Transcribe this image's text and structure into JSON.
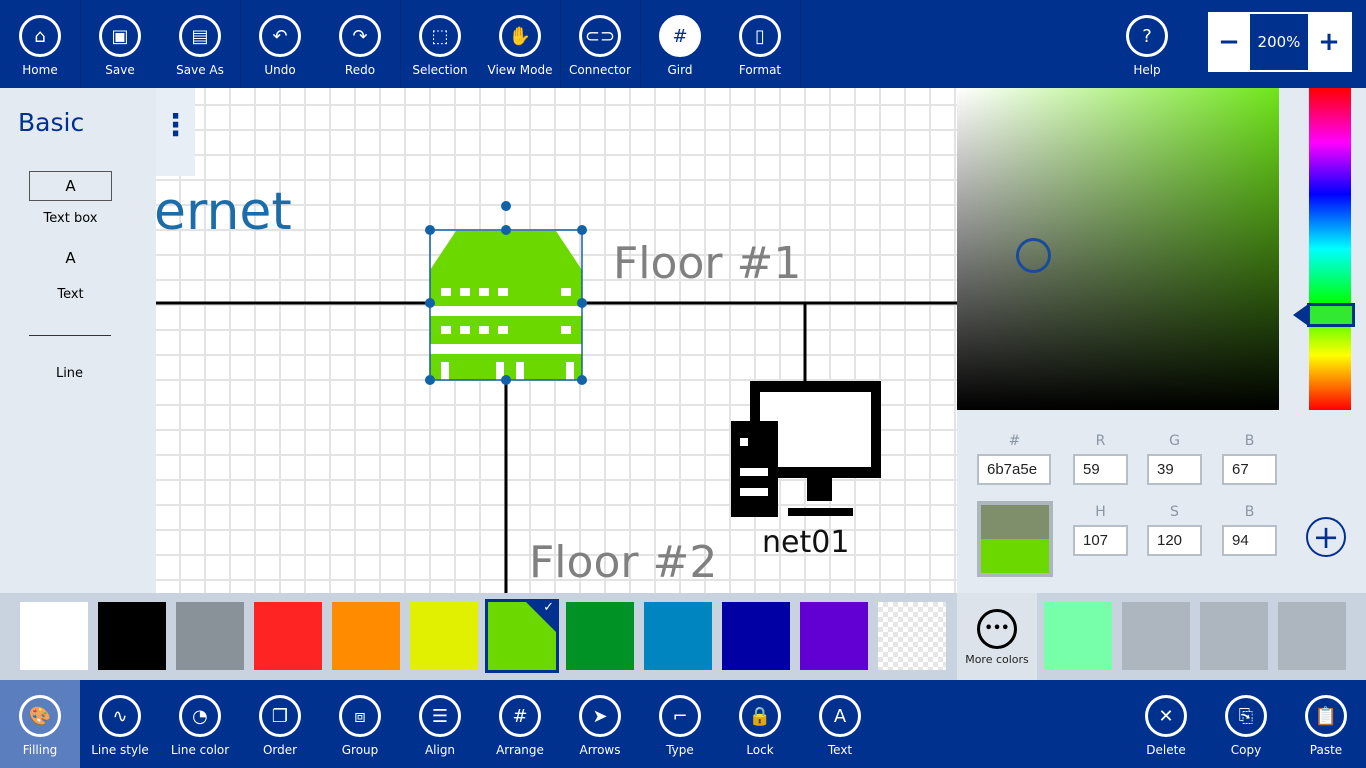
{
  "toolbar": {
    "items": [
      {
        "label": "Home",
        "icon": "home-icon",
        "glyph": "⌂"
      },
      {
        "label": "Save",
        "icon": "save-icon",
        "glyph": "▣"
      },
      {
        "label": "Save As",
        "icon": "save-as-icon",
        "glyph": "▤"
      },
      {
        "label": "Undo",
        "icon": "undo-icon",
        "glyph": "↶"
      },
      {
        "label": "Redo",
        "icon": "redo-icon",
        "glyph": "↷"
      },
      {
        "label": "Selection",
        "icon": "selection-icon",
        "glyph": "⬚"
      },
      {
        "label": "View Mode",
        "icon": "hand-icon",
        "glyph": "✋"
      },
      {
        "label": "Connector",
        "icon": "link-icon",
        "glyph": "⊂⊃"
      },
      {
        "label": "Gird",
        "icon": "grid-icon",
        "glyph": "#"
      },
      {
        "label": "Format",
        "icon": "page-icon",
        "glyph": "▯"
      }
    ],
    "help": {
      "label": "Help",
      "glyph": "?"
    },
    "zoom": {
      "minus": "−",
      "value": "200%",
      "plus": "+"
    }
  },
  "left_panel": {
    "title": "Basic",
    "items": [
      {
        "preview": "A",
        "label": "Text box"
      },
      {
        "preview": "A",
        "label": "Text"
      },
      {
        "label": "Line"
      }
    ]
  },
  "canvas": {
    "labels": {
      "internet": "ernet",
      "floor1": "Floor #1",
      "floor2": "Floor #2",
      "net01": "net01"
    },
    "more_glyph": "⋮"
  },
  "picker": {
    "hex_label": "#",
    "hex": "6b7a5e",
    "r_label": "R",
    "r": "59",
    "g_label": "G",
    "g": "39",
    "b_label": "B",
    "b": "67",
    "h_label": "H",
    "h": "107",
    "s_label": "S",
    "s": "120",
    "b2_label": "B",
    "b2": "94",
    "old_color": "#7f8f6c",
    "new_color": "#6bd900",
    "add_glyph": "+"
  },
  "palette": {
    "colors": [
      "#ffffff",
      "#000000",
      "#8a9299",
      "#ff2424",
      "#ff8c00",
      "#e0f000",
      "#6bd900",
      "#009224",
      "#0085c0",
      "#0000a4",
      "#6200d4",
      "transparent"
    ],
    "selected": 6,
    "more_colors": "More colors",
    "more_glyph": "•••",
    "recent": [
      "#77ffaa",
      "#adb6bf",
      "#adb6bf",
      "#adb6bf"
    ]
  },
  "bottombar": {
    "items": [
      {
        "label": "Filling",
        "icon": "palette-icon",
        "glyph": "🎨"
      },
      {
        "label": "Line style",
        "icon": "wave-icon",
        "glyph": "∿"
      },
      {
        "label": "Line color",
        "icon": "palette-outline-icon",
        "glyph": "◔"
      },
      {
        "label": "Order",
        "icon": "order-icon",
        "glyph": "❐"
      },
      {
        "label": "Group",
        "icon": "group-icon",
        "glyph": "⧈"
      },
      {
        "label": "Align",
        "icon": "align-icon",
        "glyph": "☰"
      },
      {
        "label": "Arrange",
        "icon": "arrange-icon",
        "glyph": "#"
      },
      {
        "label": "Arrows",
        "icon": "cursor-icon",
        "glyph": "➤"
      },
      {
        "label": "Type",
        "icon": "connector-type-icon",
        "glyph": "⌐"
      },
      {
        "label": "Lock",
        "icon": "lock-icon",
        "glyph": "🔒"
      },
      {
        "label": "Text",
        "icon": "text-icon",
        "glyph": "A"
      }
    ],
    "right": [
      {
        "label": "Delete",
        "icon": "delete-icon",
        "glyph": "✕"
      },
      {
        "label": "Copy",
        "icon": "copy-icon",
        "glyph": "⎘"
      },
      {
        "label": "Paste",
        "icon": "paste-icon",
        "glyph": "📋"
      }
    ]
  }
}
